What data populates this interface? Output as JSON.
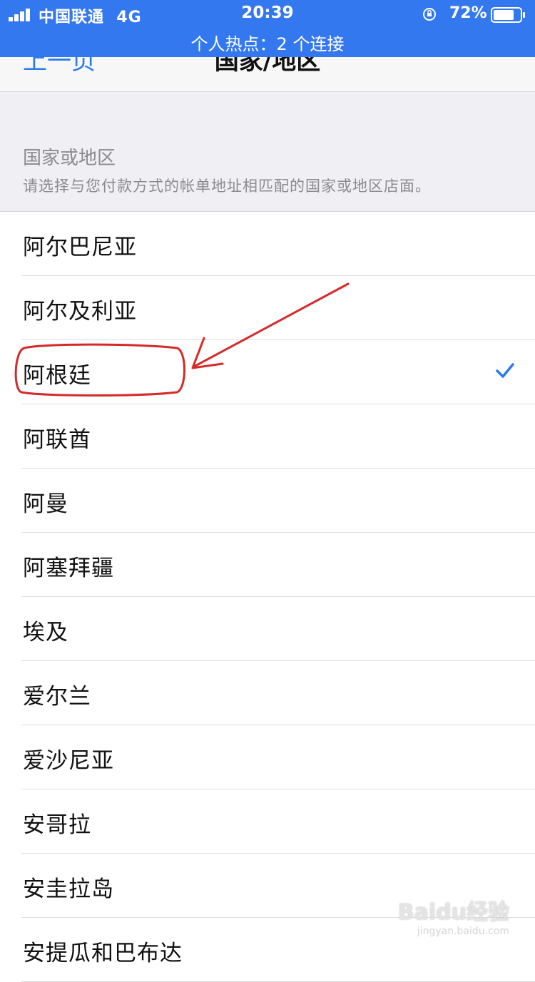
{
  "status_bar": {
    "carrier": "中国联通",
    "network": "4G",
    "time": "20:39",
    "battery": "72%",
    "hotspot": "个人热点：2 个连接",
    "color": "#3478f0"
  },
  "nav": {
    "back": "上一页",
    "title": "国家/地区"
  },
  "section": {
    "title": "国家或地区",
    "description": "请选择与您付款方式的帐单地址相匹配的国家或地区店面。"
  },
  "list": {
    "items": [
      {
        "label": "阿尔巴尼亚",
        "selected": false
      },
      {
        "label": "阿尔及利亚",
        "selected": false
      },
      {
        "label": "阿根廷",
        "selected": true
      },
      {
        "label": "阿联酋",
        "selected": false
      },
      {
        "label": "阿曼",
        "selected": false
      },
      {
        "label": "阿塞拜疆",
        "selected": false
      },
      {
        "label": "埃及",
        "selected": false
      },
      {
        "label": "爱尔兰",
        "selected": false
      },
      {
        "label": "爱沙尼亚",
        "selected": false
      },
      {
        "label": "安哥拉",
        "selected": false
      },
      {
        "label": "安圭拉岛",
        "selected": false
      },
      {
        "label": "安提瓜和巴布达",
        "selected": false
      }
    ],
    "check_icon": "checkmark-icon",
    "accent": "#2a7bef"
  },
  "annotation": {
    "color": "#d42a2a"
  },
  "watermark": {
    "main": "Baidu经验",
    "sub": "jingyan.baidu.com"
  }
}
